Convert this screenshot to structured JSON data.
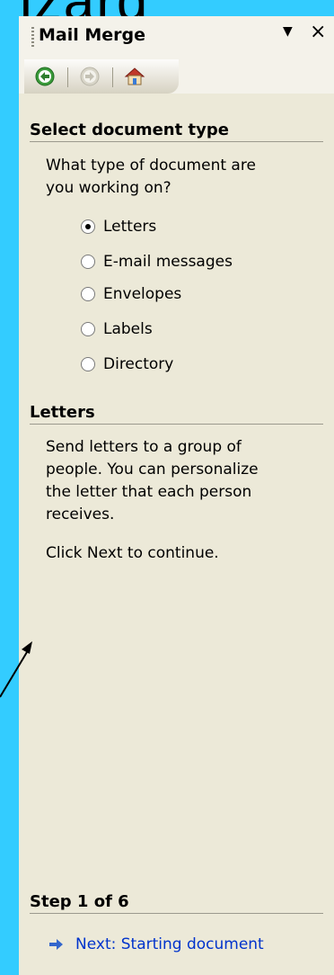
{
  "background_text": "izard",
  "pane": {
    "title": "Mail Merge",
    "menu_glyph": "▼",
    "close_glyph": "×"
  },
  "nav": {
    "icons": [
      "back-icon",
      "forward-icon",
      "home-icon"
    ]
  },
  "section_doc_type": {
    "title": "Select document type",
    "question_line1": "What type of document are",
    "question_line2": "you working on?",
    "options": [
      {
        "label": "Letters",
        "checked": true
      },
      {
        "label": "E-mail messages",
        "checked": false
      },
      {
        "label": "Envelopes",
        "checked": false
      },
      {
        "label": "Labels",
        "checked": false
      },
      {
        "label": "Directory",
        "checked": false
      }
    ]
  },
  "section_letters": {
    "title": "Letters",
    "desc_line1": "Send letters to a group of",
    "desc_line2": "people. You can personalize",
    "desc_line3": "the letter that each person",
    "desc_line4": "receives.",
    "continue_text": "Click Next to continue."
  },
  "step": {
    "title": "Step 1 of 6",
    "next_label": "Next: Starting document"
  },
  "colors": {
    "background": "#33CCFF",
    "pane": "#ECE9D8",
    "link": "#0033CC",
    "nav_green": "#3A9A3A"
  }
}
